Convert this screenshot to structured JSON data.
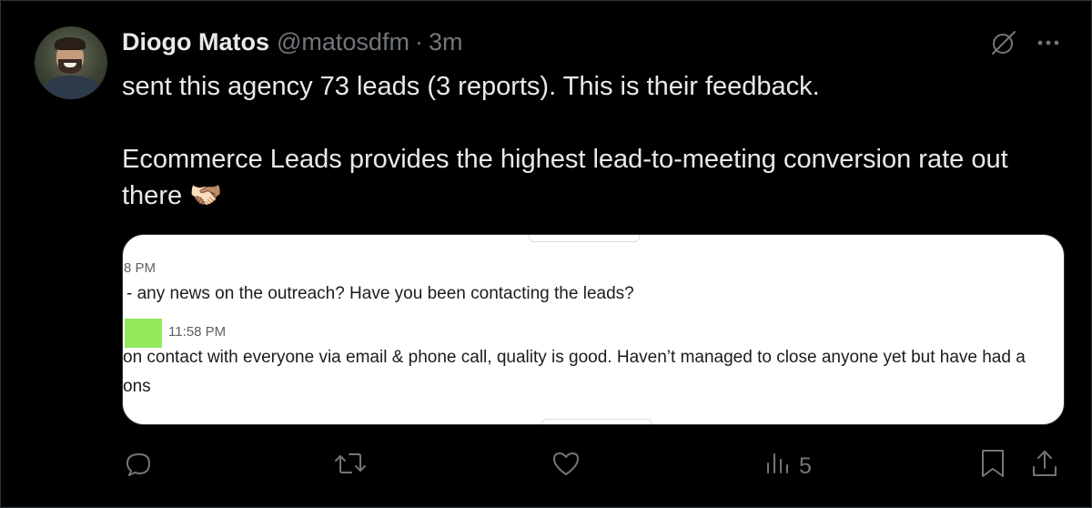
{
  "author": {
    "name": "Diogo Matos",
    "handle": "@matosdfm",
    "separator": "·",
    "time": "3m"
  },
  "tweet": {
    "line1": "sent this agency 73 leads (3 reports). This is their feedback.",
    "line2": "Ecommerce Leads provides the highest lead-to-meeting conversion rate out there 🫱🏻‍🫲🏽"
  },
  "media": {
    "time1": "8 PM",
    "msg1": "- any news on the outreach? Have you been contacting the leads?",
    "time2": "11:58 PM",
    "msg2": "on contact with everyone via email & phone call, quality is good. Haven’t managed to close anyone yet but have had a",
    "msg3": "ons"
  },
  "actions": {
    "views": "5"
  },
  "colors": {
    "background": "#000000",
    "text": "#e7e9ea",
    "muted": "#71767b",
    "highlight": "#93e85c"
  }
}
